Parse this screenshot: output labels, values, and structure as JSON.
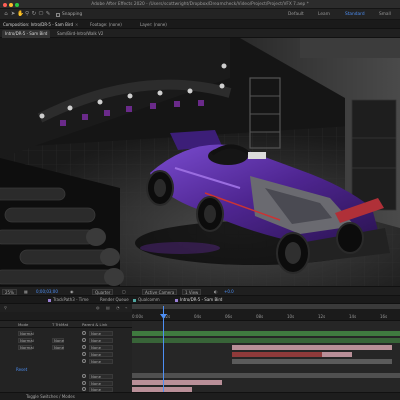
{
  "window": {
    "title": "Adobe After Effects 2020 - /Users/scottwright/Dropbox/Dreamcheck/Video/Project/Project/VFX 7.aep *",
    "traffic_colors": [
      "#ff5f57",
      "#febc2e",
      "#28c840"
    ]
  },
  "toolbar": {
    "icons": [
      "home-icon",
      "selection-tool-icon",
      "hand-tool-icon",
      "zoom-tool-icon",
      "rotate-tool-icon",
      "camera-tool-icon",
      "pen-tool-icon",
      "text-tool-icon"
    ],
    "snapping_label": "Snapping",
    "workspaces": [
      {
        "label": "Default",
        "active": false
      },
      {
        "label": "Learn",
        "active": false
      },
      {
        "label": "Standard",
        "active": true
      },
      {
        "label": "Small Scree",
        "active": false
      }
    ]
  },
  "panel_tabs": [
    {
      "label": "Composition: Intro/DR-5 - Sam Bird",
      "active": true
    },
    {
      "label": "Footage: (none)",
      "active": false
    },
    {
      "label": "Layer: (none)",
      "active": false
    }
  ],
  "comp_tabs": [
    {
      "label": "Intro/DR-5 - Sam Bird",
      "active": true
    },
    {
      "label": "Sam/Bird-Intro/Walk V2",
      "active": false
    }
  ],
  "viewer_bar": {
    "zoom": "25%",
    "timecode": "0;00;03;00",
    "resolution": "Quarter",
    "camera": "Active Camera",
    "views": "1 View",
    "exposure": "+0.0"
  },
  "timeline_tabs": [
    {
      "label": "TrackPath3 - Time",
      "color": "#9a7fd6",
      "active": false
    },
    {
      "label": "Render Queue",
      "color": "",
      "active": false
    },
    {
      "label": "Qualcomm",
      "color": "#4fa6a0",
      "active": false
    },
    {
      "label": "Intro/DR-5 - Sam Bird",
      "color": "#9a7fd6",
      "active": true
    }
  ],
  "ruler_ticks": [
    "0:00s",
    "02s",
    "04s",
    "06s",
    "08s",
    "10s",
    "12s",
    "14s",
    "16s"
  ],
  "columns": {
    "mode": "Mode",
    "trk_mat": "T TrkMat",
    "parent": "Parent & Link"
  },
  "layers": [
    {
      "mode": "Normal",
      "trkmat": "",
      "parent": "None"
    },
    {
      "mode": "Normal",
      "trkmat": "None",
      "parent": "None"
    },
    {
      "mode": "Normal",
      "trkmat": "None",
      "parent": "None"
    },
    {
      "mode": "",
      "trkmat": "",
      "parent": "None"
    },
    {
      "mode": "",
      "trkmat": "",
      "parent": "None"
    },
    {
      "mode": "",
      "trkmat": "",
      "parent": "None"
    },
    {
      "mode": "",
      "trkmat": "",
      "parent": "None"
    },
    {
      "mode": "",
      "trkmat": "",
      "parent": "None"
    },
    {
      "mode": "",
      "trkmat": "",
      "parent": "None"
    },
    {
      "mode": "",
      "trkmat": "",
      "parent": "None"
    }
  ],
  "reset_label": "Reset",
  "bottom_bar": {
    "label": "Toggle Switches / Modes"
  },
  "colors": {
    "accent": "#4d8ff4",
    "bar_green": "#3f7a3f",
    "bar_pink": "#b98f98",
    "bar_red": "#8f3a3a",
    "bar_grey": "#5b5b5b",
    "livery_purple": "#5a2ca0"
  }
}
